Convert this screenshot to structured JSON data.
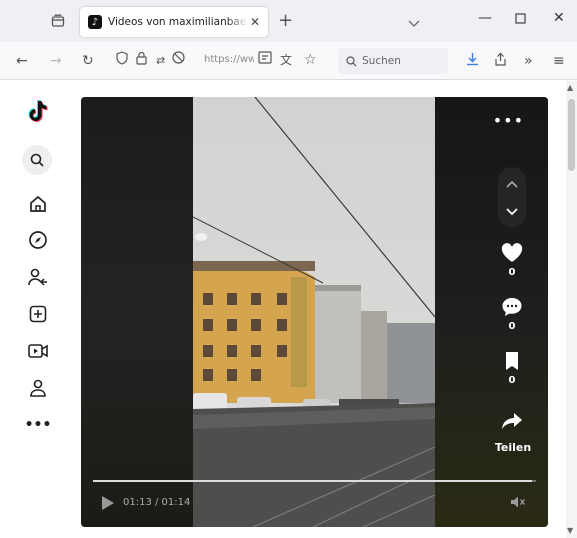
{
  "browser": {
    "tab": {
      "title": "Videos von maximilianbaehring",
      "favicon": "tiktok-icon"
    },
    "address_bar": {
      "url": "https://ww"
    },
    "search": {
      "placeholder": "Suchen"
    }
  },
  "sidebar": {
    "items": [
      {
        "name": "tiktok-logo-icon"
      },
      {
        "name": "search-icon"
      },
      {
        "name": "home-icon"
      },
      {
        "name": "explore-compass-icon"
      },
      {
        "name": "following-icon"
      },
      {
        "name": "upload-icon"
      },
      {
        "name": "live-icon"
      },
      {
        "name": "profile-icon"
      },
      {
        "name": "more-icon"
      }
    ]
  },
  "player": {
    "more_label": "•••",
    "likes": "0",
    "comments": "0",
    "bookmarks": "0",
    "share_label": "Teilen",
    "time": "01:13 / 01:14",
    "progress": 0.99
  },
  "colors": {
    "accent": "#fe2c55",
    "player_bg": "#141414"
  }
}
